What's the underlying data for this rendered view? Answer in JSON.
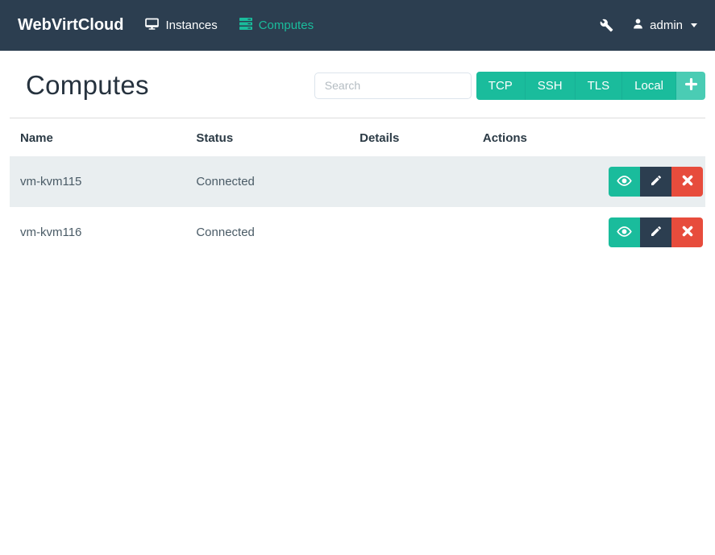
{
  "navbar": {
    "brand": "WebVirtCloud",
    "items": [
      {
        "label": "Instances",
        "icon": "monitor-icon",
        "active": false
      },
      {
        "label": "Computes",
        "icon": "server-icon",
        "active": true
      }
    ],
    "tools_icon": "wrench-icon",
    "user": {
      "icon": "user-icon",
      "name": "admin"
    }
  },
  "page": {
    "title": "Computes"
  },
  "search": {
    "placeholder": "Search"
  },
  "add_compute_buttons": {
    "tcp": "TCP",
    "ssh": "SSH",
    "tls": "TLS",
    "local": "Local",
    "add": "plus-icon"
  },
  "table": {
    "columns": [
      "Name",
      "Status",
      "Details",
      "Actions"
    ],
    "rows": [
      {
        "name": "vm-kvm115",
        "status": "Connected",
        "details": ""
      },
      {
        "name": "vm-kvm116",
        "status": "Connected",
        "details": ""
      }
    ],
    "row_actions": [
      "view",
      "edit",
      "delete"
    ]
  },
  "colors": {
    "navbar_bg": "#2c3e50",
    "accent_teal": "#1abc9c",
    "accent_teal_light": "#4accb4",
    "danger_red": "#e74c3c",
    "stripe_bg": "#e9eef0"
  }
}
